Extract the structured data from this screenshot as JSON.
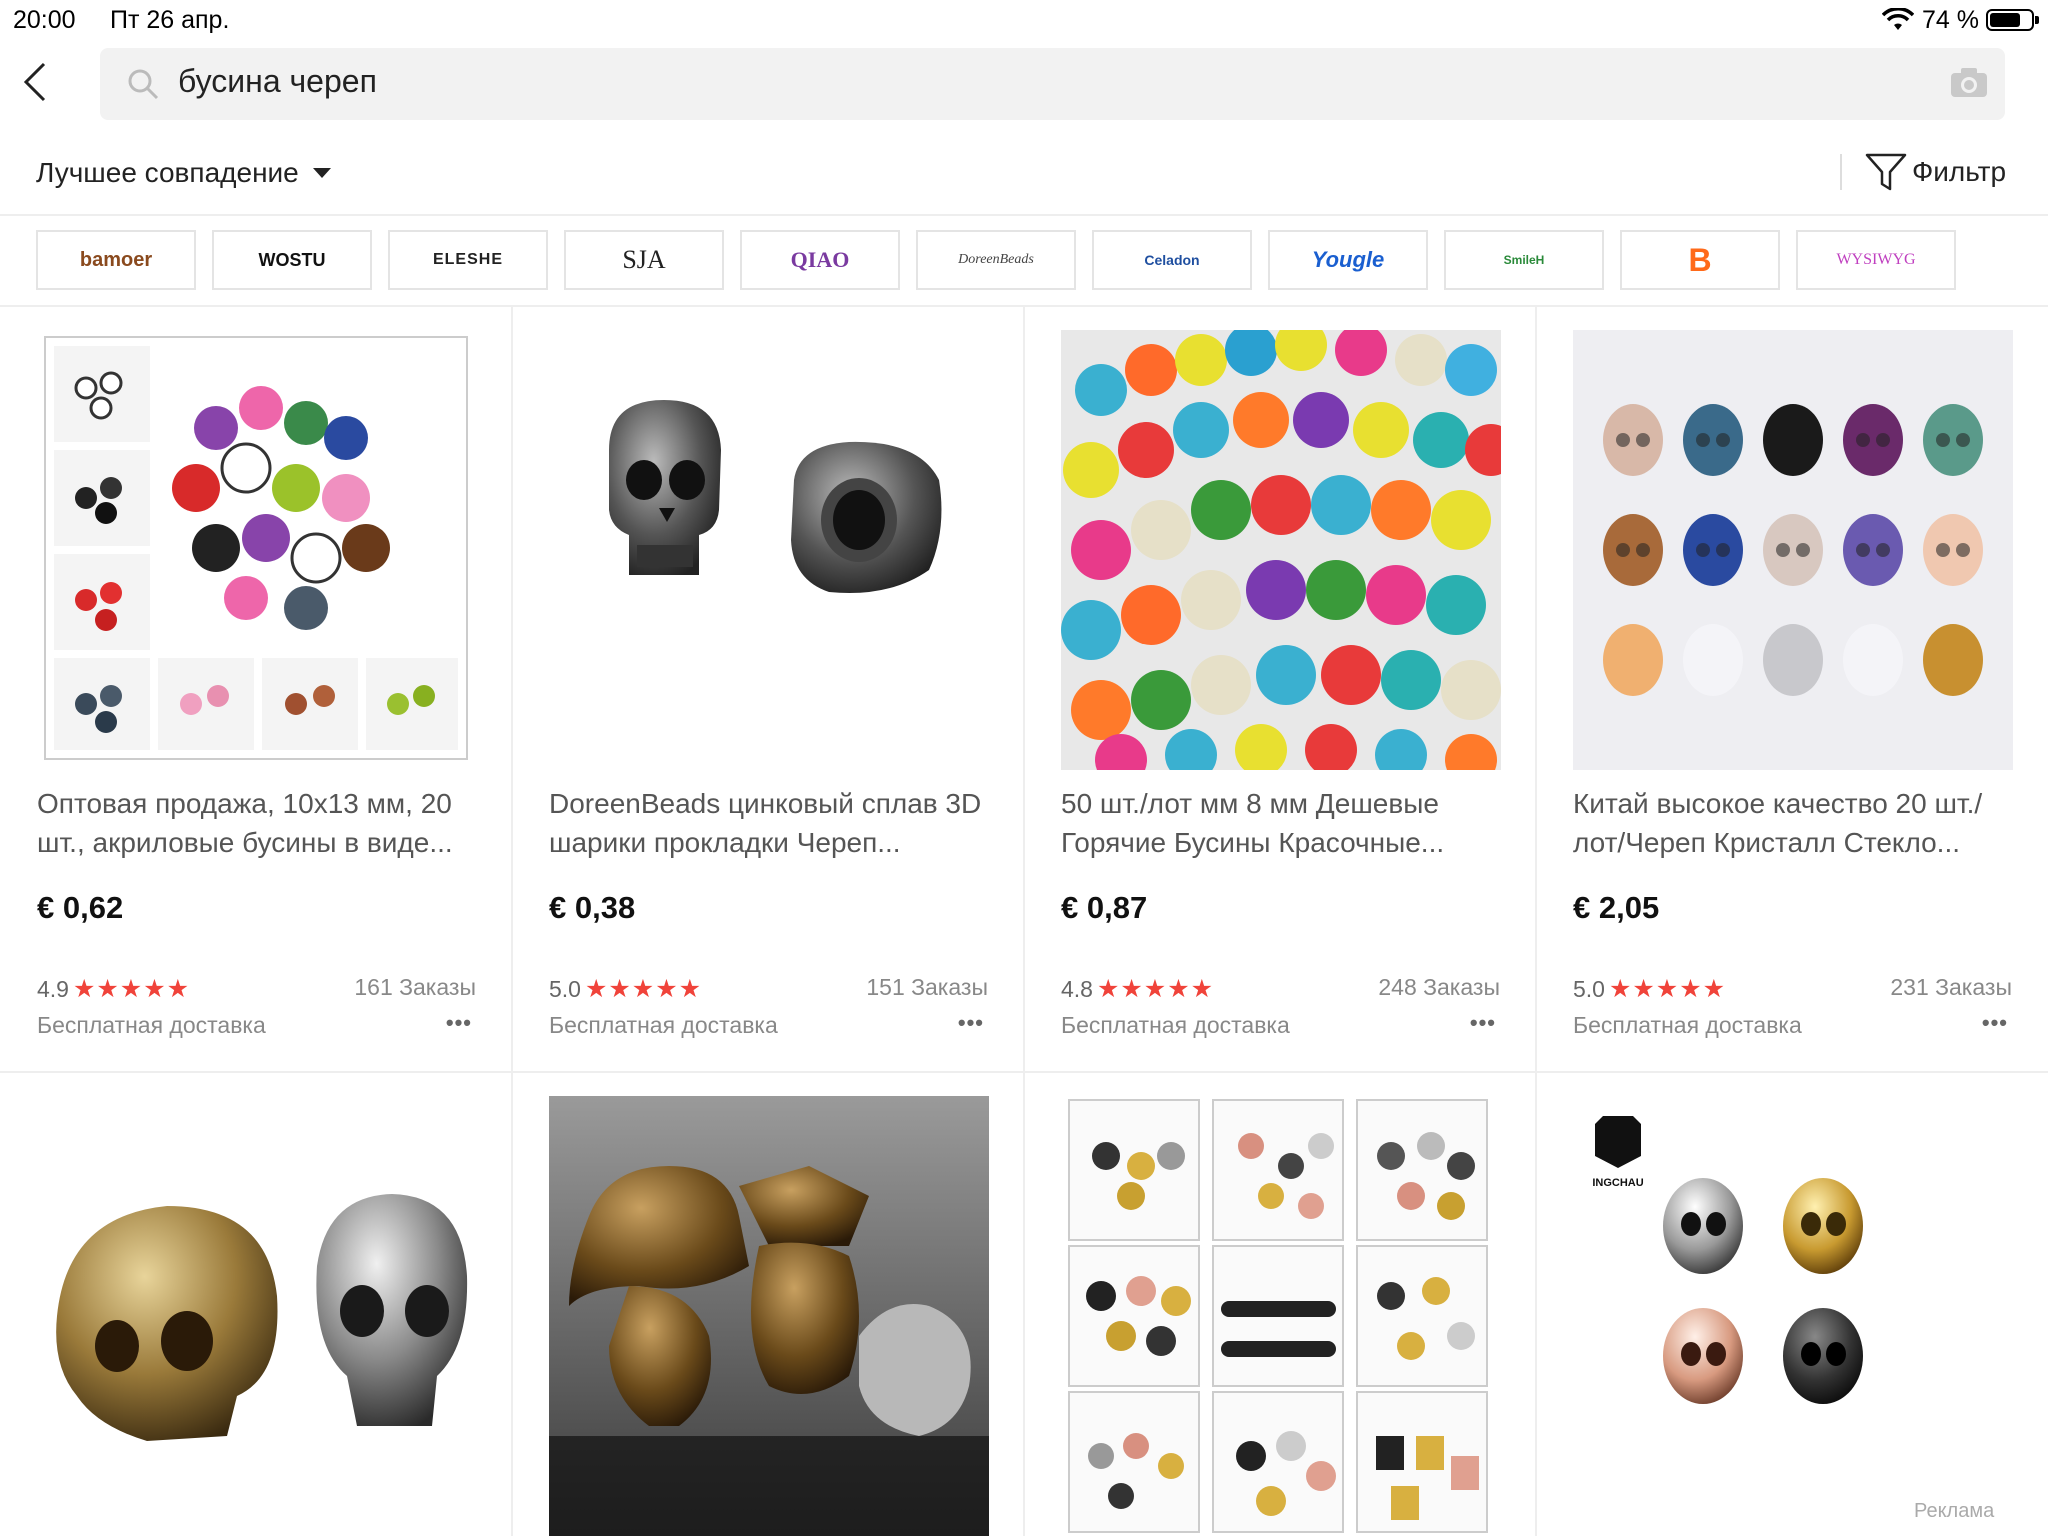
{
  "status_bar": {
    "time": "20:00",
    "date": "Пт 26 апр.",
    "battery": "74 %",
    "battery_level": 0.74
  },
  "search": {
    "query": "бусина череп"
  },
  "sort": {
    "label": "Лучшее совпадение"
  },
  "filter": {
    "label": "Фильтр"
  },
  "brands": [
    {
      "name": "bamoer",
      "color": "#8a4a1e"
    },
    {
      "name": "WOSTU",
      "color": "#111111"
    },
    {
      "name": "ELESHE",
      "color": "#222222"
    },
    {
      "name": "SJA",
      "color": "#222222"
    },
    {
      "name": "QIAO",
      "color": "#7a3aa0"
    },
    {
      "name": "DoreenBeads",
      "color": "#444444"
    },
    {
      "name": "Celadon",
      "color": "#1f4fa0"
    },
    {
      "name": "Yougle",
      "color": "#1a5fd0"
    },
    {
      "name": "SmileH",
      "color": "#2a8a3a"
    },
    {
      "name": "B",
      "color": "#ff6a1a"
    },
    {
      "name": "WYSIWYG",
      "color": "#c040c0"
    }
  ],
  "products": [
    {
      "title": "Оптовая продажа, 10x13 мм, 20 шт., акриловые бусины в виде...",
      "price": "€ 0,62",
      "rating": "4.9",
      "stars": "★★★★★",
      "orders": "161 Заказы",
      "shipping": "Бесплатная доставка"
    },
    {
      "title": "DoreenBeads цинковый сплав 3D шарики прокладки Череп...",
      "price": "€ 0,38",
      "rating": "5.0",
      "stars": "★★★★★",
      "orders": "151 Заказы",
      "shipping": "Бесплатная доставка"
    },
    {
      "title": "50 шт./лот мм 8 мм Дешевые Горячие Бусины Красочные...",
      "price": "€ 0,87",
      "rating": "4.8",
      "stars": "★★★★★",
      "orders": "248 Заказы",
      "shipping": "Бесплатная доставка"
    },
    {
      "title": "Китай высокое качество 20 шт./лот/Череп Кристалл Стекло...",
      "price": "€ 2,05",
      "rating": "5.0",
      "stars": "★★★★★",
      "orders": "231 Заказы",
      "shipping": "Бесплатная доставка"
    }
  ],
  "ad_label": "Реклама",
  "ingchau_logo": "INGCHAU",
  "more_label": "•••"
}
